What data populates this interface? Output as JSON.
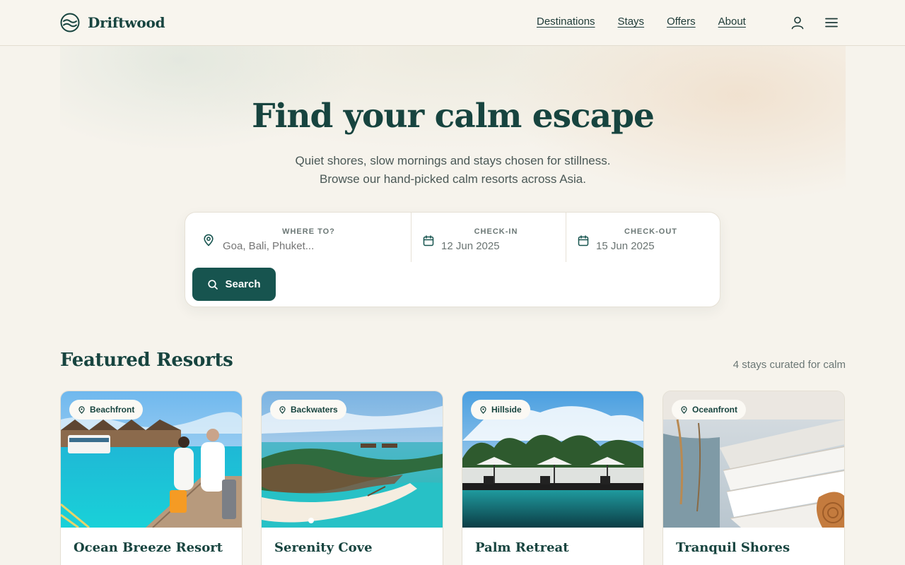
{
  "header": {
    "brand": "Driftwood",
    "nav": [
      "Destinations",
      "Stays",
      "Offers",
      "About"
    ],
    "icons": [
      "user-icon",
      "menu-icon"
    ]
  },
  "hero": {
    "title": "Find your calm escape",
    "subtitle_line1": "Quiet shores, slow mornings and stays chosen for stillness.",
    "subtitle_line2": "Browse our hand-picked calm resorts across Asia."
  },
  "search": {
    "where_label": "Where to?",
    "where_placeholder": "Goa, Bali, Phuket...",
    "checkin_label": "Check-in",
    "checkin_value": "12 Jun 2025",
    "checkout_label": "Check-out",
    "checkout_value": "15 Jun 2025",
    "button_label": "Search"
  },
  "featured": {
    "title": "Featured Resorts",
    "meta": "4 stays curated for calm",
    "resorts": [
      {
        "tag": "Beachfront",
        "name": "Ocean Breeze Resort"
      },
      {
        "tag": "Backwaters",
        "name": "Serenity Cove"
      },
      {
        "tag": "Hillside",
        "name": "Palm Retreat"
      },
      {
        "tag": "Oceanfront",
        "name": "Tranquil Shores"
      }
    ]
  },
  "colors": {
    "brand": "#17443f",
    "button": "#17544f",
    "background": "#f6f3ec"
  }
}
